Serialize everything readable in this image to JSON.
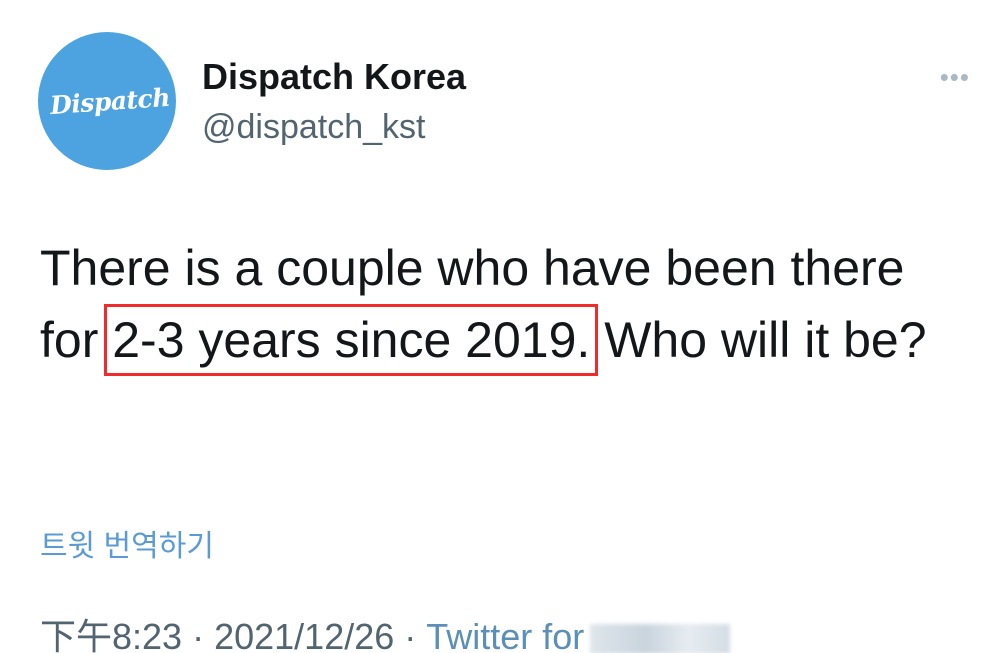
{
  "author": {
    "avatar_text": "Dispatch",
    "display_name": "Dispatch Korea",
    "handle": "@dispatch_kst"
  },
  "more_icon": "more-horizontal-icon",
  "tweet": {
    "text_before": "There is a couple who have been there for ",
    "text_highlight": "2-3 years since 2019.",
    "text_after": " Who will it be?"
  },
  "translate_label": "트윗 번역하기",
  "meta": {
    "time": "下午8:23",
    "separator": " · ",
    "date": "2021/12/26",
    "source": "Twitter for"
  },
  "colors": {
    "avatar_bg": "#4da3e0",
    "highlight_box": "#ef2b2b",
    "link": "#5b9bd5"
  }
}
